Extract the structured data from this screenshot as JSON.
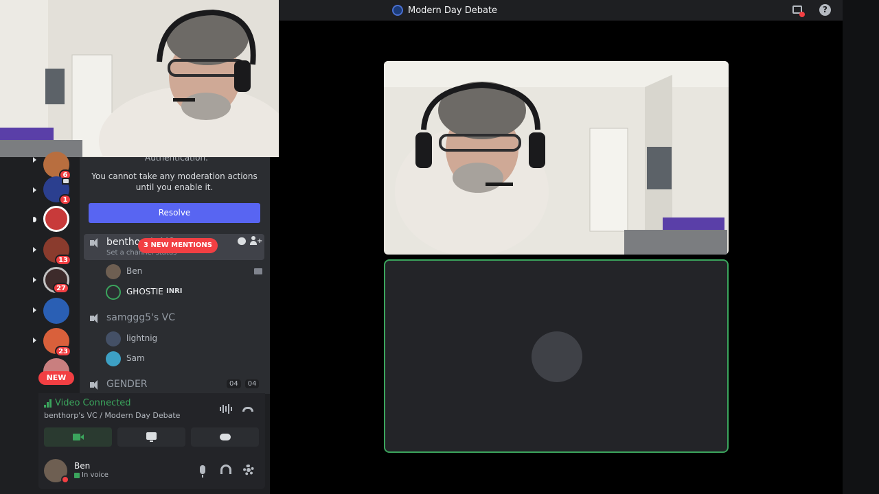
{
  "titlebar": {
    "server_name": "Modern Day Debate"
  },
  "sidebar": {
    "notice_title": "Authentication.",
    "notice_text": "You cannot take any moderation actions until you enable it.",
    "resolve_label": "Resolve",
    "mentions_label": "3 NEW MENTIONS",
    "guild_badges": [
      "6",
      "1",
      "13",
      "27",
      "23"
    ],
    "new_label": "NEW",
    "channels": [
      {
        "name": "benthorp's VC",
        "subtitle": "Set a channel status",
        "members": [
          {
            "name": "Ben"
          },
          {
            "name": "GHOSTIE",
            "tag": "INRI"
          }
        ]
      },
      {
        "name": "samggg5's VC",
        "members": [
          {
            "name": "lightnig"
          },
          {
            "name": "Sam"
          }
        ]
      },
      {
        "name": "GENDER",
        "counts": [
          "04",
          "04"
        ]
      }
    ]
  },
  "voice_panel": {
    "status": "Video Connected",
    "location": "benthorp's VC / Modern Day Debate"
  },
  "user": {
    "name": "Ben",
    "status": "In voice"
  },
  "colors": {
    "accent": "#5865f2",
    "connected": "#3ba55d",
    "danger": "#f23f43"
  }
}
